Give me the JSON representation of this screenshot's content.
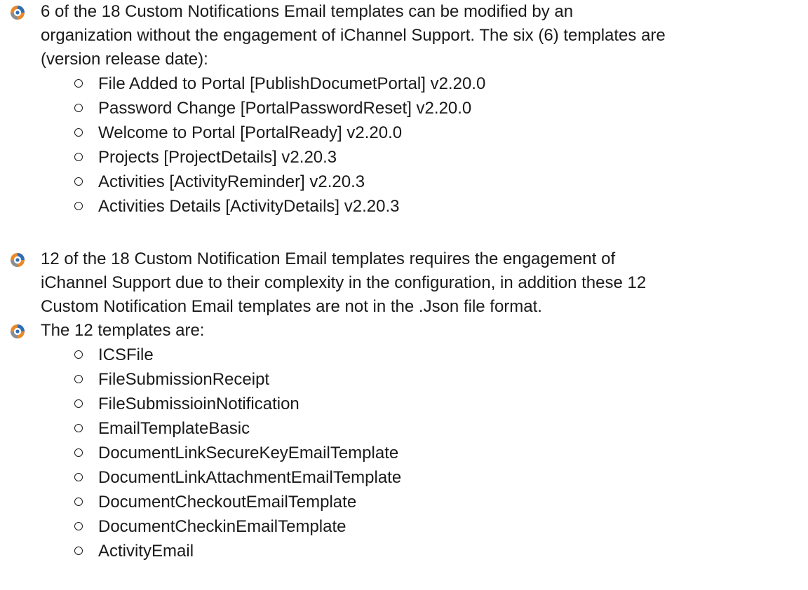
{
  "colors": {
    "text": "#1a1a1a",
    "bullet_orange": "#e8892b",
    "bullet_blue": "#2f6db5",
    "bullet_gray": "#8a8f96"
  },
  "bullet_icon": "circular-swirl-bullet-icon",
  "section1": {
    "lines": [
      "6 of the 18 Custom Notifications Email templates can be modified by an",
      "organization without the engagement of iChannel Support. The six (6) templates are",
      "(version release date):"
    ],
    "items": [
      "File Added to Portal [PublishDocumetPortal] v2.20.0",
      "Password Change [PortalPasswordReset] v2.20.0",
      "Welcome to Portal [PortalReady] v2.20.0",
      "Projects [ProjectDetails] v2.20.3",
      "Activities [ActivityReminder] v2.20.3",
      "Activities Details [ActivityDetails] v2.20.3"
    ]
  },
  "section2": {
    "lines": [
      "12 of the 18 Custom Notification Email templates requires the engagement of",
      "iChannel Support due to their complexity in the configuration, in addition these 12",
      "Custom Notification Email templates are not in the .Json file format."
    ]
  },
  "section3": {
    "lines": [
      "The 12 templates are:"
    ],
    "items": [
      "ICSFile",
      "FileSubmissionReceipt",
      "FileSubmissioinNotification",
      "EmailTemplateBasic",
      "DocumentLinkSecureKeyEmailTemplate",
      "DocumentLinkAttachmentEmailTemplate",
      "DocumentCheckoutEmailTemplate",
      "DocumentCheckinEmailTemplate",
      "ActivityEmail"
    ]
  }
}
